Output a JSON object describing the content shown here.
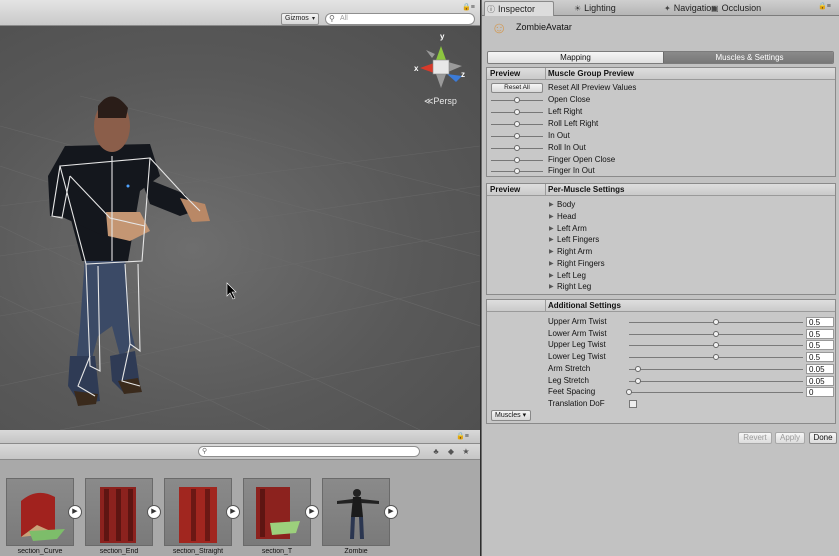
{
  "scene": {
    "gizmos_label": "Gizmos",
    "search_placeholder": "All",
    "persp_label": "Persp",
    "axis_x": "x",
    "axis_y": "y",
    "axis_z": "z",
    "colors": {
      "axis_x": "#d83a2a",
      "axis_y": "#8dc63f",
      "axis_z": "#3b7bd8"
    }
  },
  "inspector": {
    "tabs": [
      "Inspector",
      "Lighting",
      "Navigation",
      "Occlusion"
    ],
    "asset_name": "ZombieAvatar",
    "mode_toggle": {
      "mapping": "Mapping",
      "muscles": "Muscles & Settings",
      "active": "muscles"
    },
    "muscle_group_preview": {
      "col_preview": "Preview",
      "col_title": "Muscle Group Preview",
      "reset_button": "Reset All",
      "rows": [
        "Reset All Preview Values",
        "Open Close",
        "Left Right",
        "Roll Left Right",
        "In Out",
        "Roll In Out",
        "Finger Open Close",
        "Finger In Out"
      ]
    },
    "per_muscle": {
      "col_preview": "Preview",
      "col_title": "Per-Muscle Settings",
      "groups": [
        "Body",
        "Head",
        "Left Arm",
        "Left Fingers",
        "Right Arm",
        "Right Fingers",
        "Left Leg",
        "Right Leg"
      ]
    },
    "additional": {
      "title": "Additional Settings",
      "rows": [
        {
          "label": "Upper Arm Twist",
          "value": "0.5",
          "fraction": 0.5
        },
        {
          "label": "Lower Arm Twist",
          "value": "0.5",
          "fraction": 0.5
        },
        {
          "label": "Upper Leg Twist",
          "value": "0.5",
          "fraction": 0.5
        },
        {
          "label": "Lower Leg Twist",
          "value": "0.5",
          "fraction": 0.5
        },
        {
          "label": "Arm Stretch",
          "value": "0.05",
          "fraction": 0.05
        },
        {
          "label": "Leg Stretch",
          "value": "0.05",
          "fraction": 0.05
        },
        {
          "label": "Feet Spacing",
          "value": "0",
          "fraction": 0.0
        }
      ],
      "translation_dof_label": "Translation DoF",
      "translation_dof_checked": false,
      "muscles_dropdown": "Muscles"
    },
    "footer": {
      "revert": "Revert",
      "apply": "Apply",
      "done": "Done"
    }
  },
  "project": {
    "search_placeholder": "",
    "assets": [
      {
        "name": "section_Curve"
      },
      {
        "name": "section_End"
      },
      {
        "name": "section_Straight"
      },
      {
        "name": "section_T"
      },
      {
        "name": "Zombie"
      }
    ]
  }
}
